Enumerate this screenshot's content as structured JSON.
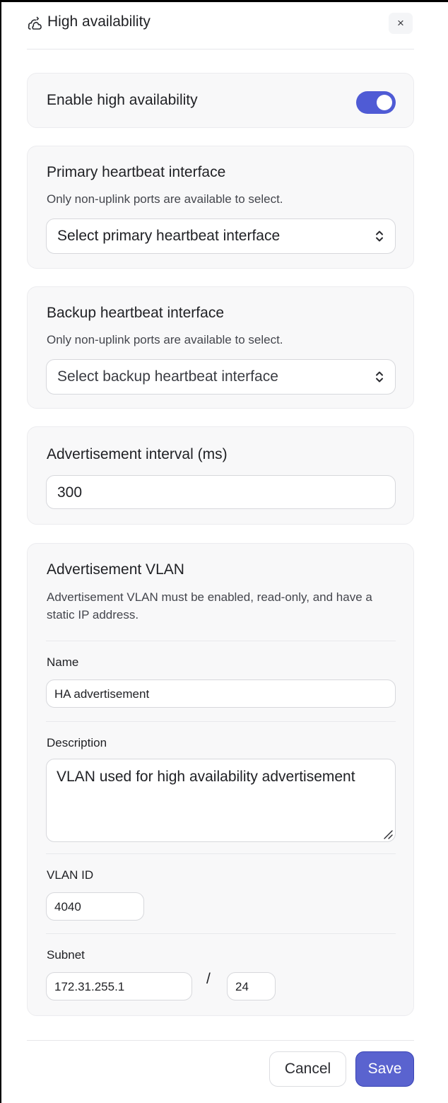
{
  "header": {
    "title": "High availability",
    "icon": "high-availability-icon",
    "close_label": "×"
  },
  "enable": {
    "label": "Enable high availability",
    "enabled": true
  },
  "primary": {
    "label": "Primary heartbeat interface",
    "help": "Only non-uplink ports are available to select.",
    "select_value": "Select primary heartbeat interface"
  },
  "backup": {
    "label": "Backup heartbeat interface",
    "help": "Only non-uplink ports are available to select.",
    "select_value": "Select backup heartbeat interface"
  },
  "interval": {
    "label": "Advertisement interval (ms)",
    "value": "300"
  },
  "vlan": {
    "label": "Advertisement VLAN",
    "help": "Advertisement VLAN must be enabled, read-only, and have a static IP address.",
    "name_label": "Name",
    "name_value": "HA advertisement",
    "description_label": "Description",
    "description_value": "VLAN used for high availability advertisement",
    "vlan_id_label": "VLAN ID",
    "vlan_id_value": "4040",
    "subnet_label": "Subnet",
    "subnet_ip": "172.31.255.1",
    "subnet_separator": "/",
    "subnet_prefix": "24"
  },
  "footer": {
    "cancel_label": "Cancel",
    "save_label": "Save"
  },
  "colors": {
    "accent": "#4f5bd5",
    "save_button": "#5a63cf",
    "card_background": "#f8f8f9"
  }
}
